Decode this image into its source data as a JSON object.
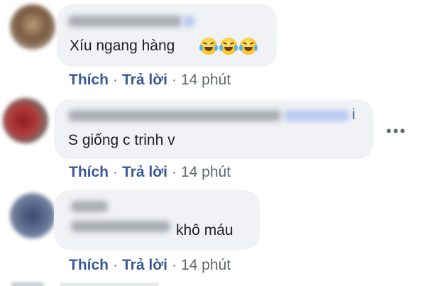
{
  "comments": [
    {
      "text": "Xíu ngang hàng",
      "emojis": [
        "tears-of-joy-icon",
        "tears-of-joy-icon",
        "tears-of-joy-icon"
      ],
      "actions": {
        "like": "Thích",
        "reply": "Trả lời",
        "dot": "·",
        "time": "14 phút"
      }
    },
    {
      "name_suffix": "i",
      "text": "S giống c trinh v",
      "actions": {
        "like": "Thích",
        "reply": "Trả lời",
        "dot": "·",
        "time": "14 phút"
      }
    },
    {
      "text": "khô máu",
      "actions": {
        "like": "Thích",
        "reply": "Trả lời",
        "dot": "·",
        "time": "14 phút"
      }
    }
  ],
  "more_menu": "•••",
  "colors": {
    "bubble": "#f0f2f5",
    "link": "#385898",
    "meta": "#606770",
    "text": "#1c1e21"
  }
}
